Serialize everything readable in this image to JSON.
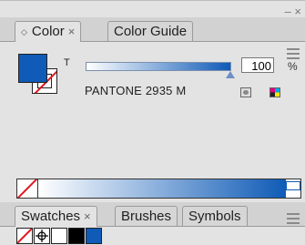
{
  "color_panel": {
    "tabs": [
      {
        "label": "Color",
        "active": true,
        "closable": true
      },
      {
        "label": "Color Guide",
        "active": false,
        "closable": false
      }
    ],
    "tint_label": "T",
    "tint_value": "100",
    "percent_sign": "%",
    "swatch_name": "PANTONE 2935 M",
    "fill_color": "#0f5bb7",
    "panel_buttons": {
      "minimize": "–",
      "close": "×"
    }
  },
  "swatches_panel": {
    "tabs": [
      {
        "label": "Swatches",
        "active": true,
        "closable": true
      },
      {
        "label": "Brushes",
        "active": false,
        "closable": false
      },
      {
        "label": "Symbols",
        "active": false,
        "closable": false
      }
    ],
    "swatch_colors": [
      "none",
      "registration",
      "#ffffff",
      "#000000",
      "#0f5bb7"
    ],
    "panel_buttons": {
      "minimize": "–",
      "close": "×"
    }
  },
  "colors": {
    "accent_blue": "#0f5bb7",
    "none_red": "#e0161d",
    "panel_bg": "#e3e3e3"
  },
  "close_glyph": "×"
}
